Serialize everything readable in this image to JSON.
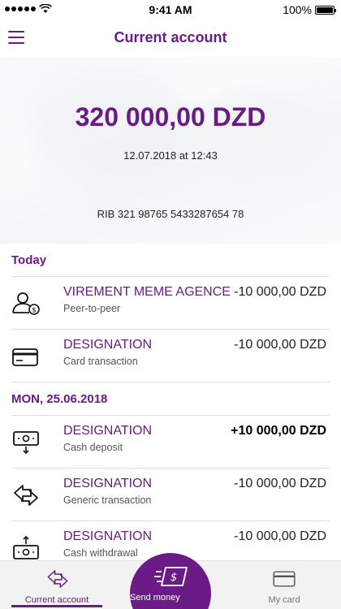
{
  "status_bar": {
    "time": "9:41 AM",
    "battery": "100%"
  },
  "header": {
    "title": "Current account",
    "menu_icon": "hamburger-menu-icon"
  },
  "account": {
    "balance": "320 000,00 DZD",
    "timestamp": "12.07.2018 at 12:43",
    "rib": "RIB 321 98765 5433287654 78"
  },
  "sections": [
    {
      "title": "Today",
      "transactions": [
        {
          "title": "VIREMENT MEME AGENCE",
          "subtitle": "Peer-to-peer",
          "amount": "-10 000,00 DZD",
          "icon": "peer-to-peer-icon"
        },
        {
          "title": "DESIGNATION",
          "subtitle": "Card transaction",
          "amount": "-10 000,00 DZD",
          "icon": "card-icon"
        }
      ]
    },
    {
      "title": "MON, 25.06.2018",
      "transactions": [
        {
          "title": "DESIGNATION",
          "subtitle": "Cash deposit",
          "amount": "+10 000,00 DZD",
          "icon": "cash-deposit-icon"
        },
        {
          "title": "DESIGNATION",
          "subtitle": "Generic transaction",
          "amount": "-10 000,00 DZD",
          "icon": "transfer-arrows-icon"
        },
        {
          "title": "DESIGNATION",
          "subtitle": "Cash withdrawal",
          "amount": "-10 000,00 DZD",
          "icon": "cash-withdrawal-icon"
        }
      ]
    }
  ],
  "tabbar": {
    "current_account": "Current account",
    "send_money": "Send money",
    "my_card": "My card"
  },
  "colors": {
    "brand": "#6a1b86",
    "tabbar_bg": "#f2f2f2"
  }
}
